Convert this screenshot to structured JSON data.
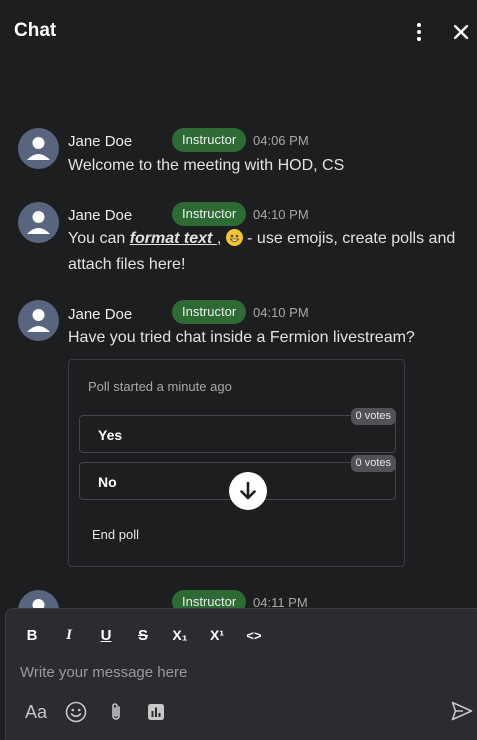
{
  "header": {
    "title": "Chat",
    "more_icon": "more-vertical-icon",
    "close_icon": "close-icon"
  },
  "messages": [
    {
      "author": "Jane Doe",
      "role": "Instructor",
      "time": "04:06 PM",
      "text": "Welcome to the meeting with HOD, CS"
    },
    {
      "author": "Jane Doe",
      "role": "Instructor",
      "time": "04:10 PM",
      "text_before": "You can ",
      "text_format": "format text ",
      "text_middle": " , ",
      "text_after": " - use emojis,  create polls and attach files here!",
      "emoji": "grinning-face-emoji"
    },
    {
      "author": "Jane Doe",
      "role": "Instructor",
      "time": "04:10 PM",
      "text": "Have you tried chat inside a Fermion livestream?",
      "poll": {
        "status": "Poll started a minute ago",
        "options": [
          {
            "label": "Yes",
            "votes": "0 votes"
          },
          {
            "label": "No",
            "votes": "0 votes"
          }
        ],
        "end_label": "End poll"
      }
    },
    {
      "author": "",
      "role": "Instructor",
      "time": "04:11 PM"
    }
  ],
  "scroll_down_icon": "arrow-down-icon",
  "composer": {
    "format_buttons": [
      "B",
      "I",
      "U",
      "S",
      "X₁",
      "X¹",
      "<>"
    ],
    "placeholder": "Write your message here",
    "toolbar_icons": [
      "text-format-icon",
      "emoji-icon",
      "attachment-icon",
      "poll-icon"
    ],
    "text_format_label": "Aa",
    "send_icon": "send-icon"
  },
  "colors": {
    "background": "#1d1e20",
    "composer": "#2b2c2f",
    "badge": "#2e6a34",
    "avatar": "#59647f"
  }
}
